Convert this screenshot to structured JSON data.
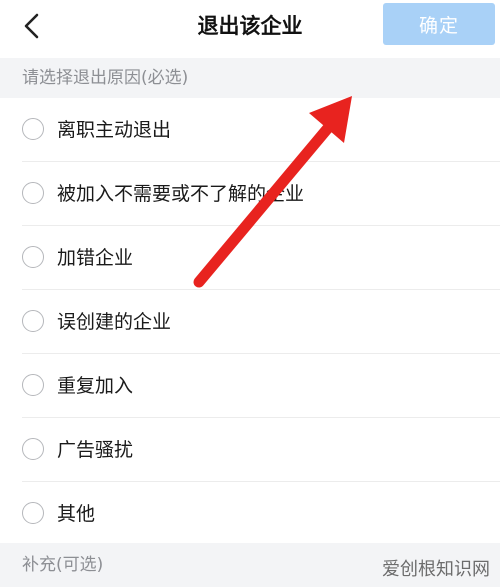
{
  "navbar": {
    "back_icon": "chevron-left-icon",
    "title": "退出该企业",
    "confirm_label": "确定",
    "confirm_color": "#a9d1f7"
  },
  "reason_section": {
    "header": "请选择退出原因(必选)",
    "options": [
      {
        "label": "离职主动退出",
        "selected": false
      },
      {
        "label": "被加入不需要或不了解的企业",
        "selected": false
      },
      {
        "label": "加错企业",
        "selected": false
      },
      {
        "label": "误创建的企业",
        "selected": false
      },
      {
        "label": "重复加入",
        "selected": false
      },
      {
        "label": "广告骚扰",
        "selected": false
      },
      {
        "label": "其他",
        "selected": false
      }
    ]
  },
  "supplement_section": {
    "header": "补充(可选)"
  },
  "watermark": {
    "text": "爱创根知识网"
  },
  "annotation": {
    "arrow_color": "#e8231f",
    "arrow_icon": "red-arrow-icon"
  }
}
